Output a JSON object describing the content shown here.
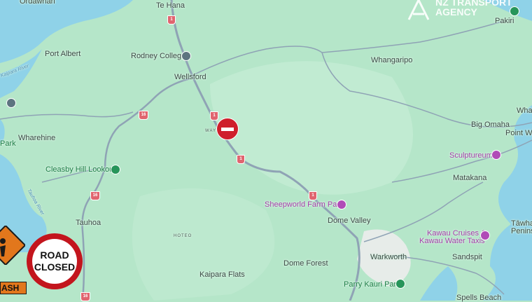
{
  "map": {
    "places": {
      "ordawhari": "Ordawhari",
      "te_hana": "Te Hana",
      "port_albert": "Port Albert",
      "rodney_college": "Rodney College",
      "wellsford": "Wellsford",
      "whangaripo": "Whangaripo",
      "pakiri": "Pakiri",
      "wharehine": "Wharehine",
      "way": "WAY",
      "cleasby_hill_lookout": "Cleasby Hill Lookout",
      "big_omaha": "Big Omaha",
      "point_we": "Point We",
      "wha": "Wha",
      "sculptureum": "Sculptureum",
      "matakana": "Matakana",
      "sheepworld": "Sheepworld Farm Park",
      "dome_valley": "Dome Valley",
      "tauhoa": "Tauhoa",
      "hoteo": "HOTEO",
      "kawau_1": "Kawau Cruises &",
      "kawau_2": "Kawau Water Taxis",
      "tawhar": "Tāwhar",
      "penins": "Penins",
      "warkworth": "Warkworth",
      "sandspit": "Sandspit",
      "dome_forest": "Dome Forest",
      "kaipara_flats": "Kaipara Flats",
      "parry_kauri_park": "Parry Kauri Park",
      "spells_beach": "Spells Beach",
      "partial_park": "Park",
      "river_1": "Kaipara River",
      "river_2": "Tauhoa River"
    },
    "highway_number": "1",
    "highway_16": "16"
  },
  "overlays": {
    "road_closed_line1": "ROAD",
    "road_closed_line2": "CLOSED",
    "crash_label": "ASH",
    "watermark_line1": "NZ TRANSPORT",
    "watermark_line2": "AGENCY"
  },
  "colors": {
    "land": "#b5e6c9",
    "water": "#8fd2e8",
    "road": "#8fa3b5",
    "highway_shield": "#e0656f",
    "poi": "#b04cb7",
    "park": "#27955a",
    "closure": "#cf1f2c"
  }
}
